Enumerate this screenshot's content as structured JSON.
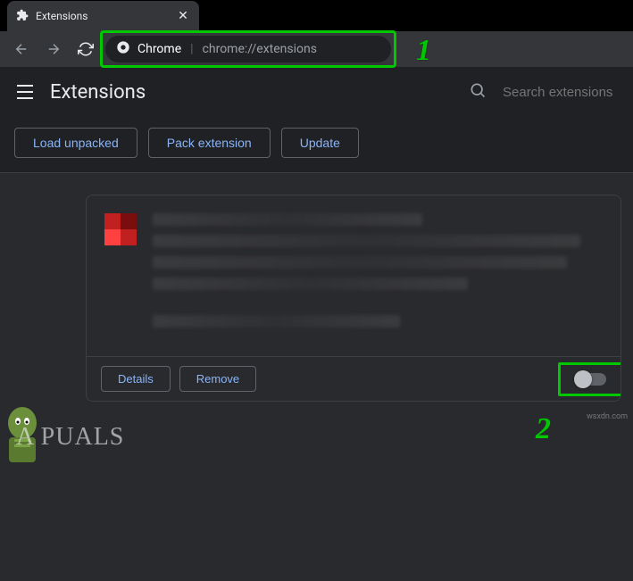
{
  "tab": {
    "title": "Extensions"
  },
  "omnibox": {
    "scheme_label": "Chrome",
    "url_display": "chrome://extensions"
  },
  "callouts": {
    "one": "1",
    "two": "2"
  },
  "header": {
    "title": "Extensions"
  },
  "search": {
    "placeholder": "Search extensions"
  },
  "actions": {
    "load_unpacked": "Load unpacked",
    "pack_extension": "Pack extension",
    "update": "Update"
  },
  "card_actions": {
    "details": "Details",
    "remove": "Remove"
  },
  "toggle": {
    "state": "off"
  },
  "watermark": {
    "brand": "A  PUALS",
    "source": "wsxdn.com"
  }
}
